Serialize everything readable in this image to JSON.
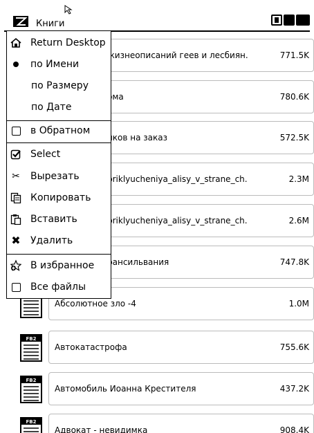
{
  "header": {
    "title": "Книги"
  },
  "status_icons": [
    "battery-icon",
    "wifi-icon",
    "volume-icon"
  ],
  "files": [
    {
      "name": "Энциклопедия жизнеописаний геев и лесбиян.",
      "visible_name": "жизнеописаний геев и лесбиян.",
      "size": "771.5K"
    },
    {
      "name": "…ома",
      "visible_name": "ома",
      "size": "780.6K"
    },
    {
      "name": "…иков на заказ",
      "visible_name": "иков на заказ",
      "size": "572.5K"
    },
    {
      "name": "…priklyucheniya_alisy_v_strane_ch.",
      "visible_name": "priklyucheniya_alisy_v_strane_ch.",
      "size": "2.3M"
    },
    {
      "name": "…priklyucheniya_alisy_v_strane_ch.",
      "visible_name": "priklyucheniya_alisy_v_strane_ch.",
      "size": "2.6M"
    },
    {
      "name": "…рансильвания",
      "visible_name": "рансильвания",
      "size": "747.8K"
    },
    {
      "name": "Абсолютное зло  -4",
      "visible_name": "Абсолютное зло  -4",
      "size": "1.0M"
    },
    {
      "name": "Автокатастрофа",
      "visible_name": "Автокатастрофа",
      "size": "755.6K",
      "badge": "FB2"
    },
    {
      "name": "Автомобиль Иоанна Крестителя",
      "visible_name": "Автомобиль Иоанна Крестителя",
      "size": "437.2K",
      "badge": "FB2"
    },
    {
      "name": "Адвокат - невидимка",
      "visible_name": "Адвокат - невидимка",
      "size": "908.4K",
      "badge": "FB2"
    }
  ],
  "menu": {
    "return_desktop": "Return Desktop",
    "sort_name": "по Имени",
    "sort_size": "по Размеру",
    "sort_date": "по Дате",
    "reverse": "в Обратном",
    "select": "Select",
    "cut": "Вырезать",
    "copy": "Копировать",
    "paste": "Вставить",
    "delete": "Удалить",
    "favorites": "В избранное",
    "all_files": "Все файлы"
  }
}
